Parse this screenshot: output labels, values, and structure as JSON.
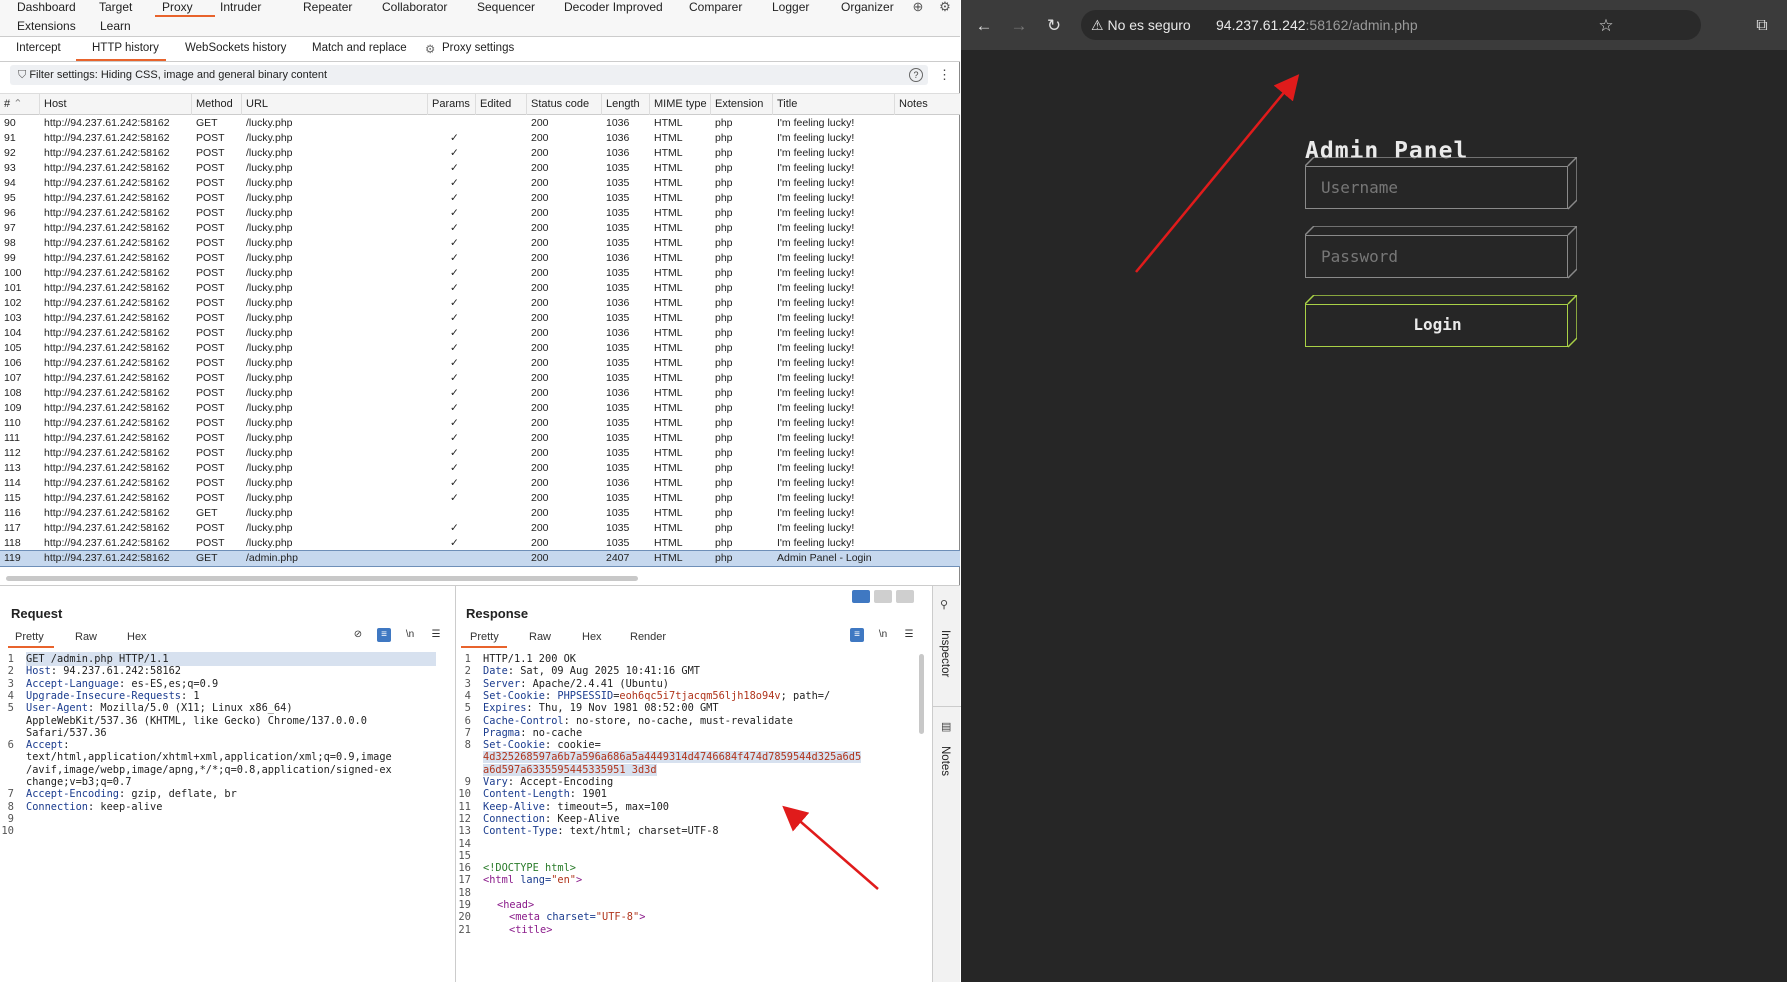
{
  "burp": {
    "top_tabs": [
      "Dashboard",
      "Target",
      "Proxy",
      "Intruder",
      "Repeater",
      "Collaborator",
      "Sequencer",
      "Decoder Improved",
      "Comparer",
      "Logger",
      "Organizer"
    ],
    "top_tabs_row2": [
      "Extensions",
      "Learn"
    ],
    "active_top_tab": "Proxy",
    "icons": {
      "globe": "globe-icon",
      "settings": "gear-icon"
    },
    "sub_tabs": [
      "Intercept",
      "HTTP history",
      "WebSockets history",
      "Match and replace",
      "Proxy settings"
    ],
    "active_sub_tab": "HTTP history",
    "filter": "Filter settings: Hiding CSS, image and general binary content",
    "filter_help": "?",
    "columns": [
      "#",
      "Host",
      "Method",
      "URL",
      "Params",
      "Edited",
      "Status code",
      "Length",
      "MIME type",
      "Extension",
      "Title",
      "Notes"
    ],
    "rows": [
      [
        "90",
        "http://94.237.61.242:58162",
        "GET",
        "/lucky.php",
        "",
        "",
        "200",
        "1036",
        "HTML",
        "php",
        "I'm feeling lucky!",
        ""
      ],
      [
        "91",
        "http://94.237.61.242:58162",
        "POST",
        "/lucky.php",
        "✓",
        "",
        "200",
        "1036",
        "HTML",
        "php",
        "I'm feeling lucky!",
        ""
      ],
      [
        "92",
        "http://94.237.61.242:58162",
        "POST",
        "/lucky.php",
        "✓",
        "",
        "200",
        "1036",
        "HTML",
        "php",
        "I'm feeling lucky!",
        ""
      ],
      [
        "93",
        "http://94.237.61.242:58162",
        "POST",
        "/lucky.php",
        "✓",
        "",
        "200",
        "1035",
        "HTML",
        "php",
        "I'm feeling lucky!",
        ""
      ],
      [
        "94",
        "http://94.237.61.242:58162",
        "POST",
        "/lucky.php",
        "✓",
        "",
        "200",
        "1035",
        "HTML",
        "php",
        "I'm feeling lucky!",
        ""
      ],
      [
        "95",
        "http://94.237.61.242:58162",
        "POST",
        "/lucky.php",
        "✓",
        "",
        "200",
        "1035",
        "HTML",
        "php",
        "I'm feeling lucky!",
        ""
      ],
      [
        "96",
        "http://94.237.61.242:58162",
        "POST",
        "/lucky.php",
        "✓",
        "",
        "200",
        "1035",
        "HTML",
        "php",
        "I'm feeling lucky!",
        ""
      ],
      [
        "97",
        "http://94.237.61.242:58162",
        "POST",
        "/lucky.php",
        "✓",
        "",
        "200",
        "1035",
        "HTML",
        "php",
        "I'm feeling lucky!",
        ""
      ],
      [
        "98",
        "http://94.237.61.242:58162",
        "POST",
        "/lucky.php",
        "✓",
        "",
        "200",
        "1035",
        "HTML",
        "php",
        "I'm feeling lucky!",
        ""
      ],
      [
        "99",
        "http://94.237.61.242:58162",
        "POST",
        "/lucky.php",
        "✓",
        "",
        "200",
        "1036",
        "HTML",
        "php",
        "I'm feeling lucky!",
        ""
      ],
      [
        "100",
        "http://94.237.61.242:58162",
        "POST",
        "/lucky.php",
        "✓",
        "",
        "200",
        "1035",
        "HTML",
        "php",
        "I'm feeling lucky!",
        ""
      ],
      [
        "101",
        "http://94.237.61.242:58162",
        "POST",
        "/lucky.php",
        "✓",
        "",
        "200",
        "1035",
        "HTML",
        "php",
        "I'm feeling lucky!",
        ""
      ],
      [
        "102",
        "http://94.237.61.242:58162",
        "POST",
        "/lucky.php",
        "✓",
        "",
        "200",
        "1036",
        "HTML",
        "php",
        "I'm feeling lucky!",
        ""
      ],
      [
        "103",
        "http://94.237.61.242:58162",
        "POST",
        "/lucky.php",
        "✓",
        "",
        "200",
        "1035",
        "HTML",
        "php",
        "I'm feeling lucky!",
        ""
      ],
      [
        "104",
        "http://94.237.61.242:58162",
        "POST",
        "/lucky.php",
        "✓",
        "",
        "200",
        "1036",
        "HTML",
        "php",
        "I'm feeling lucky!",
        ""
      ],
      [
        "105",
        "http://94.237.61.242:58162",
        "POST",
        "/lucky.php",
        "✓",
        "",
        "200",
        "1035",
        "HTML",
        "php",
        "I'm feeling lucky!",
        ""
      ],
      [
        "106",
        "http://94.237.61.242:58162",
        "POST",
        "/lucky.php",
        "✓",
        "",
        "200",
        "1035",
        "HTML",
        "php",
        "I'm feeling lucky!",
        ""
      ],
      [
        "107",
        "http://94.237.61.242:58162",
        "POST",
        "/lucky.php",
        "✓",
        "",
        "200",
        "1035",
        "HTML",
        "php",
        "I'm feeling lucky!",
        ""
      ],
      [
        "108",
        "http://94.237.61.242:58162",
        "POST",
        "/lucky.php",
        "✓",
        "",
        "200",
        "1036",
        "HTML",
        "php",
        "I'm feeling lucky!",
        ""
      ],
      [
        "109",
        "http://94.237.61.242:58162",
        "POST",
        "/lucky.php",
        "✓",
        "",
        "200",
        "1035",
        "HTML",
        "php",
        "I'm feeling lucky!",
        ""
      ],
      [
        "110",
        "http://94.237.61.242:58162",
        "POST",
        "/lucky.php",
        "✓",
        "",
        "200",
        "1035",
        "HTML",
        "php",
        "I'm feeling lucky!",
        ""
      ],
      [
        "111",
        "http://94.237.61.242:58162",
        "POST",
        "/lucky.php",
        "✓",
        "",
        "200",
        "1035",
        "HTML",
        "php",
        "I'm feeling lucky!",
        ""
      ],
      [
        "112",
        "http://94.237.61.242:58162",
        "POST",
        "/lucky.php",
        "✓",
        "",
        "200",
        "1035",
        "HTML",
        "php",
        "I'm feeling lucky!",
        ""
      ],
      [
        "113",
        "http://94.237.61.242:58162",
        "POST",
        "/lucky.php",
        "✓",
        "",
        "200",
        "1035",
        "HTML",
        "php",
        "I'm feeling lucky!",
        ""
      ],
      [
        "114",
        "http://94.237.61.242:58162",
        "POST",
        "/lucky.php",
        "✓",
        "",
        "200",
        "1036",
        "HTML",
        "php",
        "I'm feeling lucky!",
        ""
      ],
      [
        "115",
        "http://94.237.61.242:58162",
        "POST",
        "/lucky.php",
        "✓",
        "",
        "200",
        "1035",
        "HTML",
        "php",
        "I'm feeling lucky!",
        ""
      ],
      [
        "116",
        "http://94.237.61.242:58162",
        "GET",
        "/lucky.php",
        "",
        "",
        "200",
        "1035",
        "HTML",
        "php",
        "I'm feeling lucky!",
        ""
      ],
      [
        "117",
        "http://94.237.61.242:58162",
        "POST",
        "/lucky.php",
        "✓",
        "",
        "200",
        "1035",
        "HTML",
        "php",
        "I'm feeling lucky!",
        ""
      ],
      [
        "118",
        "http://94.237.61.242:58162",
        "POST",
        "/lucky.php",
        "✓",
        "",
        "200",
        "1035",
        "HTML",
        "php",
        "I'm feeling lucky!",
        ""
      ],
      [
        "119",
        "http://94.237.61.242:58162",
        "GET",
        "/admin.php",
        "",
        "",
        "200",
        "2407",
        "HTML",
        "php",
        "Admin Panel - Login",
        ""
      ]
    ],
    "selected_row": "119",
    "request": {
      "title": "Request",
      "tabs": [
        "Pretty",
        "Raw",
        "Hex"
      ],
      "line_numbers": [
        "1",
        "2",
        "3",
        "4",
        "5",
        "",
        "",
        "6",
        "",
        "",
        "",
        "7",
        "8",
        "9",
        "10"
      ],
      "lines": [
        {
          "k": "",
          "v": "GET /admin.php HTTP/1.1"
        },
        {
          "k": "Host",
          "v": ": 94.237.61.242:58162"
        },
        {
          "k": "Accept-Language",
          "v": ": es-ES,es;q=0.9"
        },
        {
          "k": "Upgrade-Insecure-Requests",
          "v": ": 1"
        },
        {
          "k": "User-Agent",
          "v": ": Mozilla/5.0 (X11; Linux x86_64)"
        },
        {
          "k": "",
          "v": "AppleWebKit/537.36 (KHTML, like Gecko) Chrome/137.0.0.0"
        },
        {
          "k": "",
          "v": "Safari/537.36"
        },
        {
          "k": "Accept",
          "v": ":"
        },
        {
          "k": "",
          "v": "text/html,application/xhtml+xml,application/xml;q=0.9,image"
        },
        {
          "k": "",
          "v": "/avif,image/webp,image/apng,*/*;q=0.8,application/signed-ex"
        },
        {
          "k": "",
          "v": "change;v=b3;q=0.7"
        },
        {
          "k": "Accept-Encoding",
          "v": ": gzip, deflate, br"
        },
        {
          "k": "Connection",
          "v": ": keep-alive"
        },
        {
          "k": "",
          "v": ""
        },
        {
          "k": "",
          "v": ""
        }
      ]
    },
    "response": {
      "title": "Response",
      "tabs": [
        "Pretty",
        "Raw",
        "Hex",
        "Render"
      ],
      "line_numbers": [
        "1",
        "2",
        "3",
        "4",
        "5",
        "6",
        "7",
        "8",
        "",
        "",
        "9",
        "10",
        "11",
        "12",
        "13",
        "14",
        "15",
        "16",
        "17",
        "18",
        "19",
        "20",
        "21"
      ],
      "status_line": "HTTP/1.1 200 OK",
      "headers": [
        {
          "k": "Date",
          "v": ": Sat, 09 Aug 2025 10:41:16 GMT"
        },
        {
          "k": "Server",
          "v": ": Apache/2.4.41 (Ubuntu)"
        },
        {
          "k": "Set-Cookie",
          "v": ": ",
          "cookie_name": "PHPSESSID",
          "cookie_eq": "=",
          "cookie_val": "eoh6qc5i7tjacqm56ljh18o94v",
          "rest": "; path=/"
        },
        {
          "k": "Expires",
          "v": ": Thu, 19 Nov 1981 08:52:00 GMT"
        },
        {
          "k": "Cache-Control",
          "v": ": no-store, no-cache, must-revalidate"
        },
        {
          "k": "Pragma",
          "v": ": no-cache"
        },
        {
          "k": "Set-Cookie",
          "v": ": cookie="
        }
      ],
      "cookie_value_lines": [
        "4d325268597a6b7a596a686a5a4449314d4746684f474d7859544d325a6d5",
        "a6d597a6335595445335951 3d3d"
      ],
      "headers2": [
        {
          "k": "Vary",
          "v": ": Accept-Encoding"
        },
        {
          "k": "Content-Length",
          "v": ": 1901"
        },
        {
          "k": "Keep-Alive",
          "v": ": timeout=5, max=100"
        },
        {
          "k": "Connection",
          "v": ": Keep-Alive"
        },
        {
          "k": "Content-Type",
          "v": ": text/html; charset=UTF-8"
        }
      ],
      "body": {
        "doctype": "<!DOCTYPE html>",
        "html_open": "<html",
        "html_attr": " lang=",
        "html_attr_val": "\"en\"",
        "html_close": ">",
        "head": "<head>",
        "meta_open": "<meta",
        "meta_attr": " charset=",
        "meta_val": "\"UTF-8\"",
        "meta_close": ">",
        "title": "<title>"
      }
    },
    "side": {
      "inspector": "Inspector",
      "notes": "Notes"
    }
  },
  "browser": {
    "warning": "No es seguro",
    "url_host": "94.237.61.242",
    "url_rest": ":58162/admin.php",
    "page": {
      "heading": "Admin Panel",
      "username_placeholder": "Username",
      "password_placeholder": "Password",
      "login_label": "Login"
    },
    "accent": "#a9d146"
  },
  "annotation_color": "#e01b1b"
}
